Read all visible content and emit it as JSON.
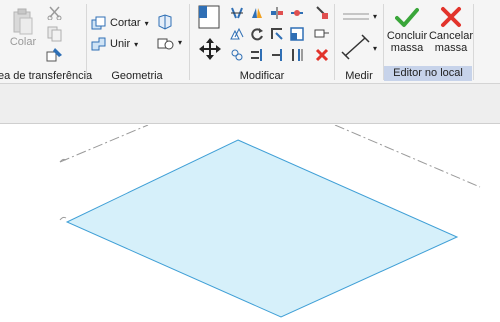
{
  "ribbon": {
    "clipboard": {
      "paste_label": "Colar",
      "title": "ea de transferência"
    },
    "geometry": {
      "cut_label": "Cortar",
      "join_label": "Unir",
      "title": "Geometria"
    },
    "modify": {
      "title": "Modificar"
    },
    "measure": {
      "title": "Medir"
    },
    "in_place_editor": {
      "finish_label_line1": "Concluir",
      "finish_label_line2": "massa",
      "cancel_label_line1": "Cancelar",
      "cancel_label_line2": "massa",
      "title": "Editor no local"
    }
  },
  "colors": {
    "finish_green": "#3aa63a",
    "cancel_red": "#e2332b",
    "mass_fill": "#d6f0fa",
    "mass_edge": "#3f9fd6",
    "editor_highlight": "#c7d3ea"
  },
  "icons": [
    "paste-icon",
    "cut-scissors-icon",
    "copy-icon",
    "match-properties-icon",
    "cut-geometry-icon",
    "join-geometry-icon",
    "align-icon",
    "move-icon",
    "rotate-icon",
    "mirror-icon",
    "array-icon",
    "scale-icon",
    "trim-icon",
    "offset-icon",
    "split-icon",
    "pin-icon",
    "unpin-icon",
    "delete-icon",
    "measure-icon",
    "dimension-icon",
    "finish-check-icon",
    "cancel-x-icon"
  ]
}
